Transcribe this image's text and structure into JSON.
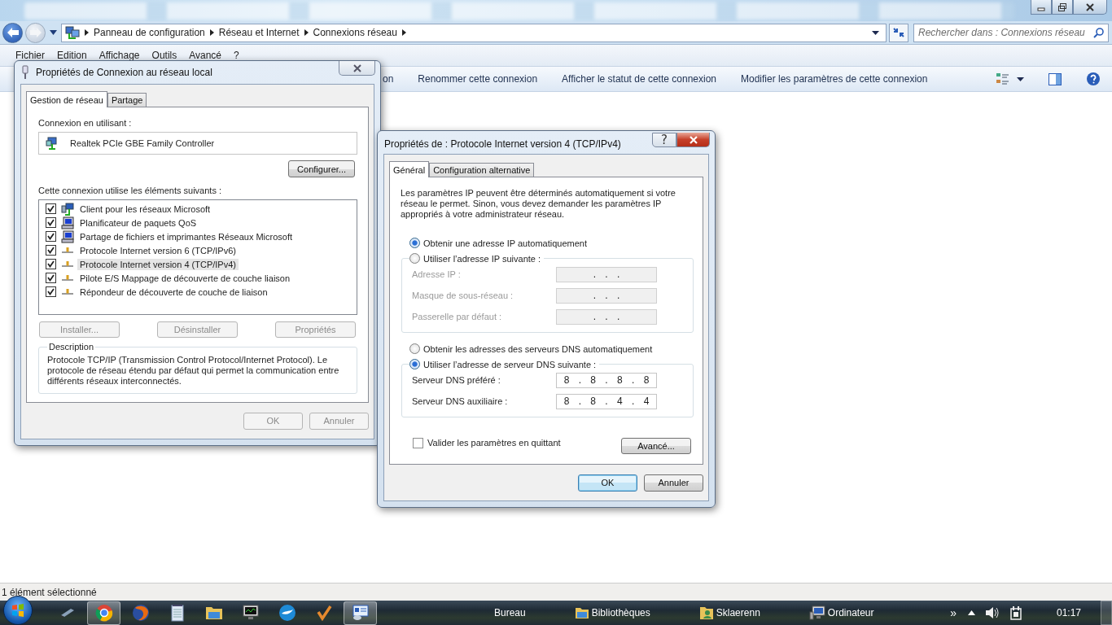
{
  "explorer": {
    "breadcrumb": [
      "Panneau de configuration",
      "Réseau et Internet",
      "Connexions réseau"
    ],
    "search": {
      "placeholder": "Rechercher dans : Connexions réseau"
    },
    "menu": [
      "Fichier",
      "Edition",
      "Affichage",
      "Outils",
      "Avancé",
      "?"
    ],
    "commands": [
      "on",
      "Renommer cette connexion",
      "Afficher le statut de cette connexion",
      "Modifier les paramètres de cette connexion"
    ],
    "status": "1 élément sélectionné"
  },
  "lan_dialog": {
    "title": "Propriétés de Connexion au réseau local",
    "tabs": [
      {
        "label": "Gestion de réseau",
        "selected": true
      },
      {
        "label": "Partage",
        "selected": false
      }
    ],
    "connect_label": "Connexion en utilisant :",
    "adapter": "Realtek PCIe GBE Family Controller",
    "configure": "Configurer...",
    "components_label": "Cette connexion utilise les éléments suivants :",
    "items": [
      {
        "label": "Client pour les réseaux Microsoft",
        "kind": "client",
        "checked": true,
        "selected": false
      },
      {
        "label": "Planificateur de paquets QoS",
        "kind": "service",
        "checked": true,
        "selected": false
      },
      {
        "label": "Partage de fichiers et imprimantes Réseaux Microsoft",
        "kind": "service",
        "checked": true,
        "selected": false
      },
      {
        "label": "Protocole Internet version 6 (TCP/IPv6)",
        "kind": "protocol",
        "checked": true,
        "selected": false
      },
      {
        "label": "Protocole Internet version 4 (TCP/IPv4)",
        "kind": "protocol",
        "checked": true,
        "selected": true
      },
      {
        "label": "Pilote E/S Mappage de découverte de couche liaison",
        "kind": "protocol",
        "checked": true,
        "selected": false
      },
      {
        "label": "Répondeur de découverte de couche de liaison",
        "kind": "protocol",
        "checked": true,
        "selected": false
      }
    ],
    "actions": [
      {
        "label": "Installer...",
        "disabled": true
      },
      {
        "label": "Désinstaller",
        "disabled": true
      },
      {
        "label": "Propriétés",
        "disabled": true
      }
    ],
    "description": {
      "title": "Description",
      "text": "Protocole TCP/IP (Transmission Control Protocol/Internet Protocol). Le protocole de réseau étendu par défaut qui permet la communication entre différents réseaux interconnectés."
    },
    "buttons": [
      {
        "label": "OK",
        "disabled": true
      },
      {
        "label": "Annuler",
        "disabled": true
      }
    ]
  },
  "ipv4_dialog": {
    "title": "Propriétés de : Protocole Internet version 4 (TCP/IPv4)",
    "help": "?",
    "tabs": [
      {
        "label": "Général",
        "selected": true
      },
      {
        "label": "Configuration alternative",
        "selected": false
      }
    ],
    "intro": "Les paramètres IP peuvent être déterminés automatiquement si votre réseau le permet. Sinon, vous devez demander les paramètres IP appropriés à votre administrateur réseau.",
    "ip_options": [
      {
        "label": "Obtenir une adresse IP automatiquement",
        "selected": true
      },
      {
        "label": "Utiliser l’adresse IP suivante :",
        "selected": false
      }
    ],
    "ip_fields": [
      {
        "label": "Adresse IP :",
        "value": ". . .",
        "disabled": true
      },
      {
        "label": "Masque de sous-réseau :",
        "value": ". . .",
        "disabled": true
      },
      {
        "label": "Passerelle par défaut :",
        "value": ". . .",
        "disabled": true
      }
    ],
    "dns_options": [
      {
        "label": "Obtenir les adresses des serveurs DNS automatiquement",
        "selected": false
      },
      {
        "label": "Utiliser l’adresse de serveur DNS suivante :",
        "selected": true
      }
    ],
    "dns_fields": [
      {
        "label": "Serveur DNS préféré :",
        "value": "8 . 8 . 8 . 8",
        "disabled": false
      },
      {
        "label": "Serveur DNS auxiliaire :",
        "value": "8 . 8 . 4 . 4",
        "disabled": false
      }
    ],
    "validate": {
      "label": "Valider les paramètres en quittant",
      "checked": false
    },
    "advanced": "Avancé...",
    "buttons": [
      {
        "label": "OK",
        "default": true
      },
      {
        "label": "Annuler",
        "default": false
      }
    ]
  },
  "taskbar": {
    "apps": [
      {
        "kind": "pen",
        "active": false
      },
      {
        "kind": "ring",
        "active": true
      },
      {
        "kind": "globe",
        "active": false
      },
      {
        "kind": "notepad",
        "active": false
      },
      {
        "kind": "folder",
        "active": false
      },
      {
        "kind": "monitor",
        "active": false
      },
      {
        "kind": "bird",
        "active": false
      },
      {
        "kind": "check",
        "active": false
      },
      {
        "kind": "network",
        "active": true
      }
    ],
    "toolbars": [
      {
        "label": "Bureau",
        "kind": "none"
      },
      {
        "label": "Bibliothèques",
        "kind": "folder"
      },
      {
        "label": "Sklaerenn",
        "kind": "user"
      },
      {
        "label": "Ordinateur",
        "kind": "computer"
      }
    ],
    "overflow": "»",
    "clock": "01:17"
  }
}
